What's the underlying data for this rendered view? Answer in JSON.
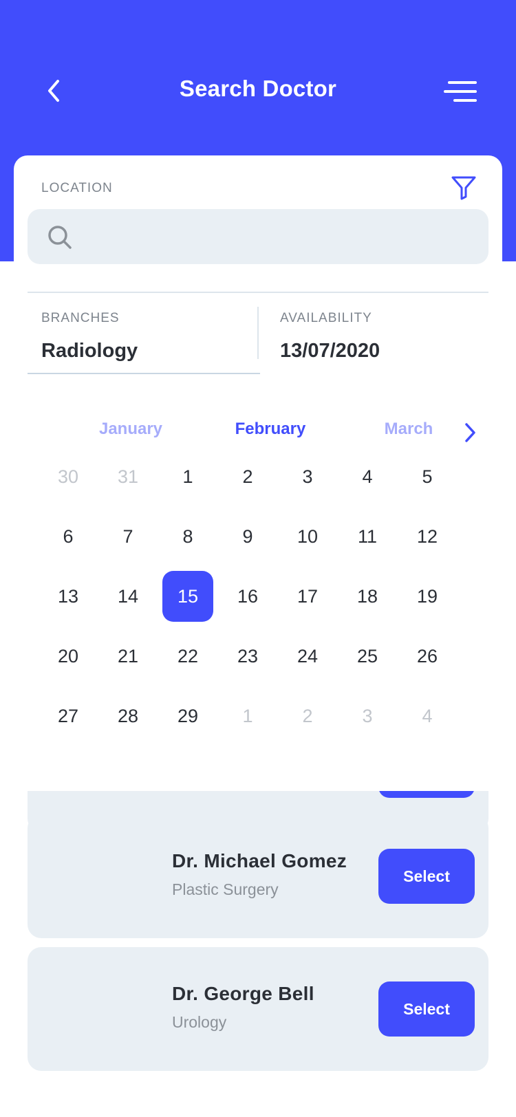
{
  "header": {
    "title": "Search Doctor",
    "back_icon": "chevron-left-icon",
    "menu_icon": "menu-icon",
    "background_color": "#414dfc"
  },
  "search": {
    "location_label": "LOCATION",
    "location_value": "",
    "placeholder": "",
    "filter_icon": "filter-icon",
    "search_icon": "search-icon"
  },
  "fields": {
    "branches_label": "BRANCHES",
    "branches_value": "Radiology",
    "availability_label": "AVAILABILITY",
    "availability_value": "13/07/2020"
  },
  "calendar": {
    "months": [
      "January",
      "February",
      "March"
    ],
    "current_month": "February",
    "next_icon": "chevron-right-icon",
    "accent_color": "#414dfc",
    "selected_day": "15",
    "weeks": [
      [
        {
          "d": "30",
          "m": true
        },
        {
          "d": "31",
          "m": true
        },
        {
          "d": "1"
        },
        {
          "d": "2"
        },
        {
          "d": "3"
        },
        {
          "d": "4"
        },
        {
          "d": "5"
        }
      ],
      [
        {
          "d": "6"
        },
        {
          "d": "7"
        },
        {
          "d": "8"
        },
        {
          "d": "9"
        },
        {
          "d": "10"
        },
        {
          "d": "11"
        },
        {
          "d": "12"
        }
      ],
      [
        {
          "d": "13"
        },
        {
          "d": "14"
        },
        {
          "d": "15",
          "s": true
        },
        {
          "d": "16"
        },
        {
          "d": "17"
        },
        {
          "d": "18"
        },
        {
          "d": "19"
        }
      ],
      [
        {
          "d": "20"
        },
        {
          "d": "21"
        },
        {
          "d": "22"
        },
        {
          "d": "23"
        },
        {
          "d": "24"
        },
        {
          "d": "25"
        },
        {
          "d": "26"
        }
      ],
      [
        {
          "d": "27"
        },
        {
          "d": "28"
        },
        {
          "d": "29"
        },
        {
          "d": "1",
          "m": true
        },
        {
          "d": "2",
          "m": true
        },
        {
          "d": "3",
          "m": true
        },
        {
          "d": "4",
          "m": true
        }
      ]
    ]
  },
  "doctors": [
    {
      "name": "Dr. Michael Gomez",
      "specialty": "Plastic Surgery",
      "button_label": "Select"
    },
    {
      "name": "Dr. George Bell",
      "specialty": "Urology",
      "button_label": "Select"
    }
  ]
}
